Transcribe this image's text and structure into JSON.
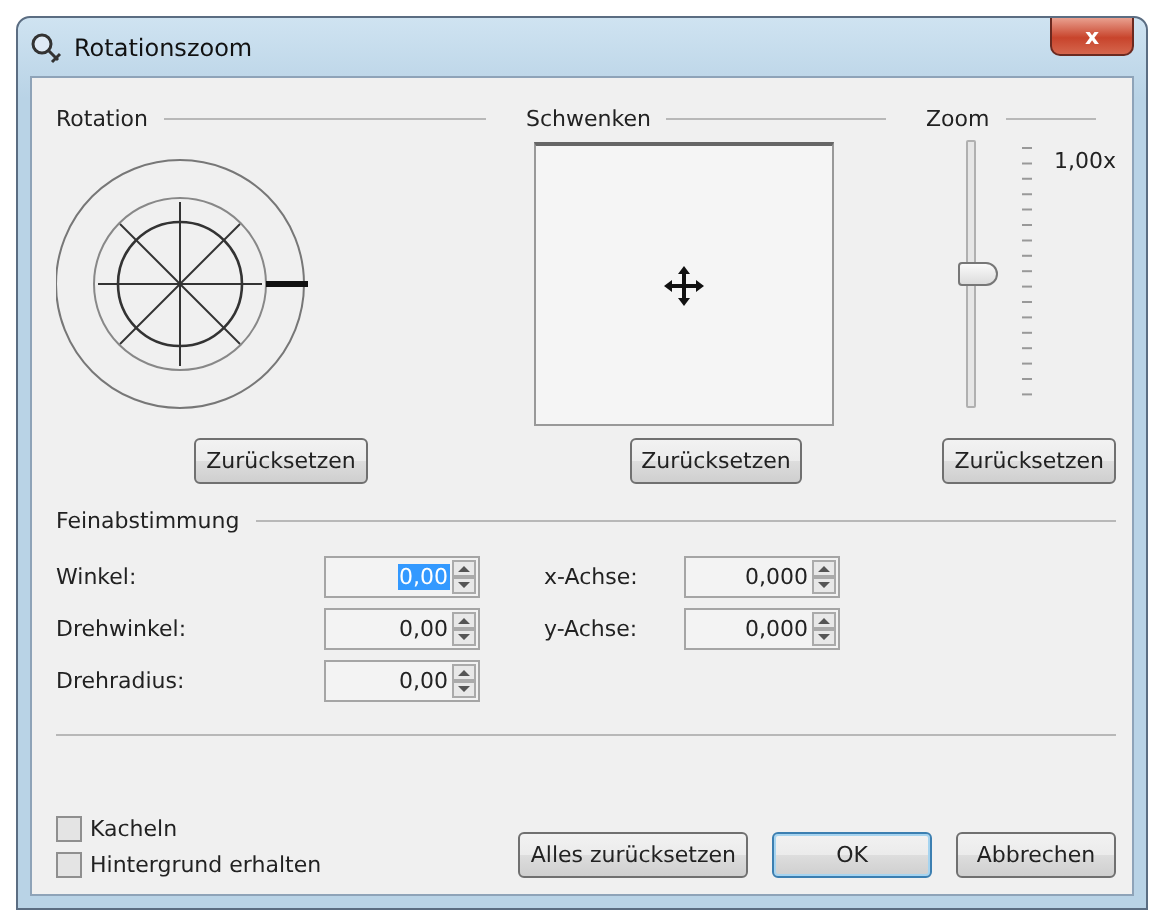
{
  "window": {
    "title": "Rotationszoom",
    "close": "x"
  },
  "groups": [
    {
      "title": "Rotation",
      "kind": "dial",
      "reset": "Zurücksetzen"
    },
    {
      "title": "Schwenken",
      "kind": "pan",
      "reset": "Zurücksetzen"
    },
    {
      "title": "Zoom",
      "kind": "slider",
      "level": 0.5,
      "reading": "1,00x",
      "reset": "Zurücksetzen"
    }
  ],
  "fine_tuning": {
    "title": "Feinabstimmung",
    "left": [
      {
        "label": "Winkel:",
        "value": "0,00",
        "focused": true
      },
      {
        "label": "Drehwinkel:",
        "value": "0,00",
        "focused": false
      },
      {
        "label": "Drehradius:",
        "value": "0,00",
        "focused": false
      }
    ],
    "right": [
      {
        "label": "x-Achse:",
        "value": "0,000",
        "focused": false
      },
      {
        "label": "y-Achse:",
        "value": "0,000",
        "focused": false
      }
    ]
  },
  "options": [
    {
      "label": "Kacheln",
      "checked": false
    },
    {
      "label": "Hintergrund erhalten",
      "checked": false
    }
  ],
  "buttons": [
    {
      "label": "Alles zurücksetzen",
      "default": false
    },
    {
      "label": "OK",
      "default": true
    },
    {
      "label": "Abbrechen",
      "default": false
    }
  ]
}
